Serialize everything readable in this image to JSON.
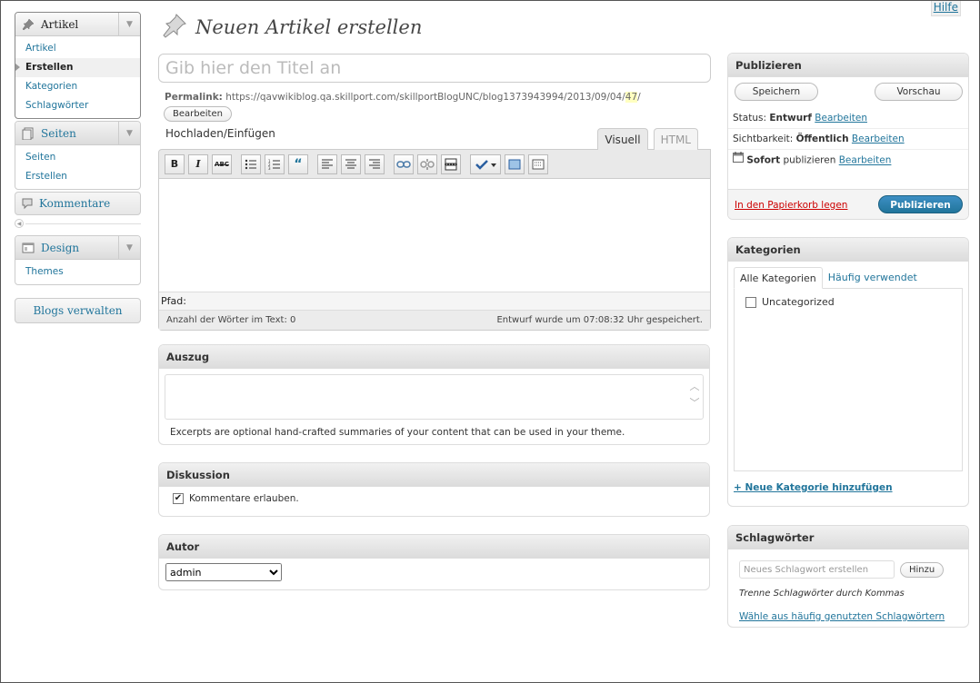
{
  "help": "Hilfe",
  "page_title": "Neuen Artikel erstellen",
  "nav": {
    "articles": {
      "label": "Artikel",
      "items": [
        "Artikel",
        "Erstellen",
        "Kategorien",
        "Schlagwörter"
      ]
    },
    "pages": {
      "label": "Seiten",
      "items": [
        "Seiten",
        "Erstellen"
      ]
    },
    "comments": {
      "label": "Kommentare"
    },
    "design": {
      "label": "Design",
      "items": [
        "Themes"
      ]
    },
    "manage_blogs": "Blogs verwalten"
  },
  "post": {
    "title_placeholder": "Gib hier den Titel an",
    "permalink_label": "Permalink:",
    "permalink_base": "https://qavwikiblog.qa.skillport.com/skillportBlogUNC/blog1373943994/2013/09/04/",
    "permalink_slug": "47",
    "permalink_end": "/",
    "edit_button": "Bearbeiten",
    "upload_label": "Hochladen/Einfügen",
    "tab_visual": "Visuell",
    "tab_html": "HTML",
    "path_label": "Pfad:",
    "word_count": "Anzahl der Wörter im Text: 0",
    "autosave": "Entwurf wurde um 07:08:32 Uhr gespeichert."
  },
  "excerpt": {
    "title": "Auszug",
    "hint": "Excerpts are optional hand-crafted summaries of your content that can be used in your theme."
  },
  "discussion": {
    "title": "Diskussion",
    "allow_comments": "Kommentare erlauben.",
    "checked": true
  },
  "author": {
    "title": "Autor",
    "selected": "admin"
  },
  "publish": {
    "title": "Publizieren",
    "save": "Speichern",
    "preview": "Vorschau",
    "status_label": "Status:",
    "status_value": "Entwurf",
    "visibility_label": "Sichtbarkeit:",
    "visibility_value": "Öffentlich",
    "schedule_value": "Sofort",
    "schedule_label": "publizieren",
    "edit_link": "Bearbeiten",
    "trash": "In den Papierkorb legen",
    "publish_button": "Publizieren"
  },
  "categories": {
    "title": "Kategorien",
    "tab_all": "Alle Kategorien",
    "tab_popular": "Häufig verwendet",
    "items": [
      {
        "label": "Uncategorized",
        "checked": false
      }
    ],
    "add_new": "+ Neue Kategorie hinzufügen"
  },
  "tags": {
    "title": "Schlagwörter",
    "input_placeholder": "Neues Schlagwort erstellen",
    "add_button": "Hinzu",
    "hint": "Trenne Schlagwörter durch Kommas",
    "choose_popular": "Wähle aus häufig genutzten Schlagwörtern"
  },
  "colors": {
    "link": "#21759b",
    "publish_button": "#21759b",
    "trash": "#cc0000"
  }
}
